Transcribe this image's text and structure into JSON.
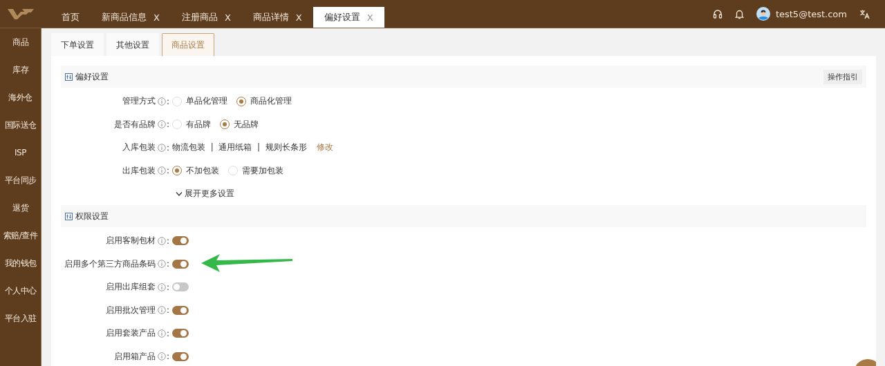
{
  "top_tabs": [
    {
      "label": "首页",
      "selected": false
    },
    {
      "label": "新商品信息",
      "close": "X",
      "selected": false
    },
    {
      "label": "注册商品",
      "close": "X",
      "selected": false
    },
    {
      "label": "商品详情",
      "close": "X",
      "selected": false
    },
    {
      "label": "偏好设置",
      "close": "X",
      "selected": true
    }
  ],
  "user": {
    "email": "test5@test.com"
  },
  "sidebar": {
    "items": [
      {
        "label": "商品"
      },
      {
        "label": "库存"
      },
      {
        "label": "海外仓"
      },
      {
        "label": "国际送仓"
      },
      {
        "label": "ISP"
      },
      {
        "label": "平台同步"
      },
      {
        "label": "退货"
      },
      {
        "label": "索赔/查件"
      },
      {
        "label": "我的钱包"
      },
      {
        "label": "个人中心"
      },
      {
        "label": "平台入驻"
      }
    ]
  },
  "sub_tabs": [
    {
      "label": "下单设置",
      "selected": false
    },
    {
      "label": "其他设置",
      "selected": false
    },
    {
      "label": "商品设置",
      "selected": true
    }
  ],
  "sections": [
    {
      "title": "偏好设置",
      "guide_button": "操作指引",
      "expand_link": "展开更多设置",
      "rows": [
        {
          "kind": "radio",
          "label": "管理方式",
          "colon": ":",
          "options": [
            {
              "label": "单品化管理",
              "selected": false
            },
            {
              "label": "商品化管理",
              "selected": true
            }
          ]
        },
        {
          "kind": "radio",
          "label": "是否有品牌",
          "colon": ":",
          "options": [
            {
              "label": "有品牌",
              "selected": false
            },
            {
              "label": "无品牌",
              "selected": true
            }
          ]
        },
        {
          "kind": "text",
          "label": "入库包装",
          "colon": ":",
          "value": "物流包装  |  通用纸箱  |  规则长条形",
          "link": "修改"
        },
        {
          "kind": "radio",
          "label": "出库包装",
          "colon": ":",
          "options": [
            {
              "label": "不加包装",
              "selected": true
            },
            {
              "label": "需要加包装",
              "selected": false
            }
          ]
        }
      ]
    },
    {
      "title": "权限设置",
      "rows": [
        {
          "kind": "toggle",
          "label": "启用客制包材",
          "colon": ":",
          "on": true
        },
        {
          "kind": "toggle",
          "label": "启用多个第三方商品条码",
          "colon": ":",
          "on": true,
          "annotated": true
        },
        {
          "kind": "toggle",
          "label": "启用出库组套",
          "colon": ":",
          "on": false
        },
        {
          "kind": "toggle",
          "label": "启用批次管理",
          "colon": ":",
          "on": true
        },
        {
          "kind": "toggle",
          "label": "启用套装产品",
          "colon": ":",
          "on": true
        },
        {
          "kind": "toggle",
          "label": "启用箱产品",
          "colon": ":",
          "on": true
        }
      ]
    }
  ]
}
